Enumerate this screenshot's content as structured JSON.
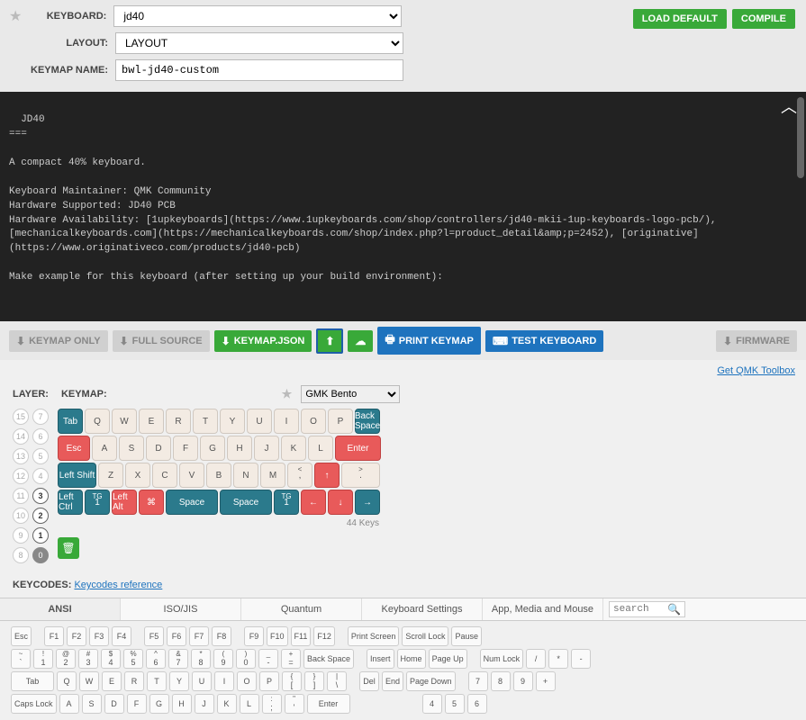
{
  "form": {
    "keyboard_label": "KEYBOARD:",
    "keyboard_value": "jd40",
    "layout_label": "LAYOUT:",
    "layout_value": "LAYOUT",
    "keymap_label": "KEYMAP NAME:",
    "keymap_value": "bwl-jd40-custom"
  },
  "top_buttons": {
    "load_default": "LOAD DEFAULT",
    "compile": "COMPILE"
  },
  "readme": "JD40\n===\n\nA compact 40% keyboard.\n\nKeyboard Maintainer: QMK Community\nHardware Supported: JD40 PCB\nHardware Availability: [1upkeyboards](https://www.1upkeyboards.com/shop/controllers/jd40-mkii-1up-keyboards-logo-pcb/), [mechanicalkeyboards.com](https://mechanicalkeyboards.com/shop/index.php?l=product_detail&amp;p=2452), [originative](https://www.originativeco.com/products/jd40-pcb)\n\nMake example for this keyboard (after setting up your build environment):",
  "toolbar": {
    "keymap_only": "KEYMAP ONLY",
    "full_source": "FULL SOURCE",
    "keymap_json": "KEYMAP.JSON",
    "print": "PRINT KEYMAP",
    "test": "TEST KEYBOARD",
    "firmware": "FIRMWARE"
  },
  "toolbox_link": "Get QMK Toolbox",
  "labels": {
    "layer": "LAYER:",
    "keymap": "KEYMAP:",
    "keycodes": "KEYCODES:",
    "keycodes_ref": "Keycodes reference"
  },
  "colorway": {
    "value": "GMK Bento"
  },
  "layers": [
    "15",
    "14",
    "13",
    "12",
    "11",
    "10",
    "9",
    "8",
    "7",
    "6",
    "5",
    "4",
    "3",
    "2",
    "1",
    "0"
  ],
  "active_layers": [
    "3",
    "2",
    "1",
    "0"
  ],
  "key_count": "44 Keys",
  "kb_rows": [
    [
      {
        "l": "Tab",
        "c": "teal",
        "w": "w1"
      },
      {
        "l": "Q",
        "w": "w1"
      },
      {
        "l": "W",
        "w": "w1"
      },
      {
        "l": "E",
        "w": "w1"
      },
      {
        "l": "R",
        "w": "w1"
      },
      {
        "l": "T",
        "w": "w1"
      },
      {
        "l": "Y",
        "w": "w1"
      },
      {
        "l": "U",
        "w": "w1"
      },
      {
        "l": "I",
        "w": "w1"
      },
      {
        "l": "O",
        "w": "w1"
      },
      {
        "l": "P",
        "w": "w1"
      },
      {
        "l": "Back Space",
        "c": "teal",
        "w": "w1"
      }
    ],
    [
      {
        "l": "Esc",
        "c": "red",
        "w": "w125"
      },
      {
        "l": "A",
        "w": "w1"
      },
      {
        "l": "S",
        "w": "w1"
      },
      {
        "l": "D",
        "w": "w1"
      },
      {
        "l": "F",
        "w": "w1"
      },
      {
        "l": "G",
        "w": "w1"
      },
      {
        "l": "H",
        "w": "w1"
      },
      {
        "l": "J",
        "w": "w1"
      },
      {
        "l": "K",
        "w": "w1"
      },
      {
        "l": "L",
        "w": "w1"
      },
      {
        "l": "Enter",
        "c": "red",
        "w": "w175"
      }
    ],
    [
      {
        "l": "Left Shift",
        "c": "teal",
        "w": "w15"
      },
      {
        "l": "Z",
        "w": "w1"
      },
      {
        "l": "X",
        "w": "w1"
      },
      {
        "l": "C",
        "w": "w1"
      },
      {
        "l": "V",
        "w": "w1"
      },
      {
        "l": "B",
        "w": "w1"
      },
      {
        "l": "N",
        "w": "w1"
      },
      {
        "l": "M",
        "w": "w1"
      },
      {
        "l": ",",
        "s": "<",
        "w": "w1"
      },
      {
        "l": "↑",
        "c": "red",
        "w": "w1"
      },
      {
        "l": ".",
        "s": ">",
        "w": "w15"
      }
    ],
    [
      {
        "l": "Left Ctrl",
        "c": "teal",
        "w": "w1"
      },
      {
        "l": "1",
        "s": "TG",
        "c": "teal",
        "w": "w1"
      },
      {
        "l": "Left Alt",
        "c": "red",
        "w": "w1"
      },
      {
        "l": "⌘",
        "c": "red",
        "w": "w1"
      },
      {
        "l": "Space",
        "c": "teal",
        "w": "w2"
      },
      {
        "l": "Space",
        "c": "teal",
        "w": "w2"
      },
      {
        "l": "1",
        "s": "TG",
        "c": "teal",
        "w": "w1"
      },
      {
        "l": "←",
        "c": "red",
        "w": "w1"
      },
      {
        "l": "↓",
        "c": "red",
        "w": "w1"
      },
      {
        "l": "→",
        "c": "teal",
        "w": "w1"
      }
    ]
  ],
  "tabs": [
    "ANSI",
    "ISO/JIS",
    "Quantum",
    "Keyboard Settings",
    "App, Media and Mouse"
  ],
  "search_placeholder": "search",
  "kc_rows": [
    [
      {
        "l": "Esc"
      },
      {
        "gap": 1
      },
      {
        "l": "F1"
      },
      {
        "l": "F2"
      },
      {
        "l": "F3"
      },
      {
        "l": "F4"
      },
      {
        "gap": 1
      },
      {
        "l": "F5"
      },
      {
        "l": "F6"
      },
      {
        "l": "F7"
      },
      {
        "l": "F8"
      },
      {
        "gap": 1
      },
      {
        "l": "F9"
      },
      {
        "l": "F10"
      },
      {
        "l": "F11"
      },
      {
        "l": "F12"
      },
      {
        "gap": 1
      },
      {
        "l": "Print Screen"
      },
      {
        "l": "Scroll Lock"
      },
      {
        "l": "Pause"
      }
    ],
    [
      {
        "t": "~",
        "l": "`"
      },
      {
        "t": "!",
        "l": "1"
      },
      {
        "t": "@",
        "l": "2"
      },
      {
        "t": "#",
        "l": "3"
      },
      {
        "t": "$",
        "l": "4"
      },
      {
        "t": "%",
        "l": "5"
      },
      {
        "t": "^",
        "l": "6"
      },
      {
        "t": "&",
        "l": "7"
      },
      {
        "t": "*",
        "l": "8"
      },
      {
        "t": "(",
        "l": "9"
      },
      {
        "t": ")",
        "l": "0"
      },
      {
        "t": "_",
        "l": "-"
      },
      {
        "t": "+",
        "l": "="
      },
      {
        "l": "Back Space",
        "w": "w2k"
      },
      {
        "gap": 1
      },
      {
        "l": "Insert"
      },
      {
        "l": "Home"
      },
      {
        "l": "Page Up"
      },
      {
        "gap": 1
      },
      {
        "l": "Num Lock"
      },
      {
        "l": "/"
      },
      {
        "l": "*"
      },
      {
        "l": "-"
      }
    ],
    [
      {
        "l": "Tab",
        "w": "w2k"
      },
      {
        "l": "Q"
      },
      {
        "l": "W"
      },
      {
        "l": "E"
      },
      {
        "l": "R"
      },
      {
        "l": "T"
      },
      {
        "l": "Y"
      },
      {
        "l": "U"
      },
      {
        "l": "I"
      },
      {
        "l": "O"
      },
      {
        "l": "P"
      },
      {
        "t": "{",
        "l": "["
      },
      {
        "t": "}",
        "l": "]"
      },
      {
        "t": "|",
        "l": "\\"
      },
      {
        "gap": 1
      },
      {
        "l": "Del"
      },
      {
        "l": "End"
      },
      {
        "l": "Page Down"
      },
      {
        "gap": 1
      },
      {
        "l": "7"
      },
      {
        "l": "8"
      },
      {
        "l": "9"
      },
      {
        "l": "+"
      }
    ],
    [
      {
        "l": "Caps Lock",
        "w": "w2k"
      },
      {
        "l": "A"
      },
      {
        "l": "S"
      },
      {
        "l": "D"
      },
      {
        "l": "F"
      },
      {
        "l": "G"
      },
      {
        "l": "H"
      },
      {
        "l": "J"
      },
      {
        "l": "K"
      },
      {
        "l": "L"
      },
      {
        "t": ":",
        "l": ";"
      },
      {
        "t": "\"",
        "l": "'"
      },
      {
        "l": "Enter",
        "w": "w2k"
      },
      {
        "gap": 1
      },
      {
        "gap": 1
      },
      {
        "gap": 1
      },
      {
        "gap": 1
      },
      {
        "gap": 1
      },
      {
        "gap": 1
      },
      {
        "gap": 1
      },
      {
        "l": "4"
      },
      {
        "l": "5"
      },
      {
        "l": "6"
      }
    ]
  ]
}
